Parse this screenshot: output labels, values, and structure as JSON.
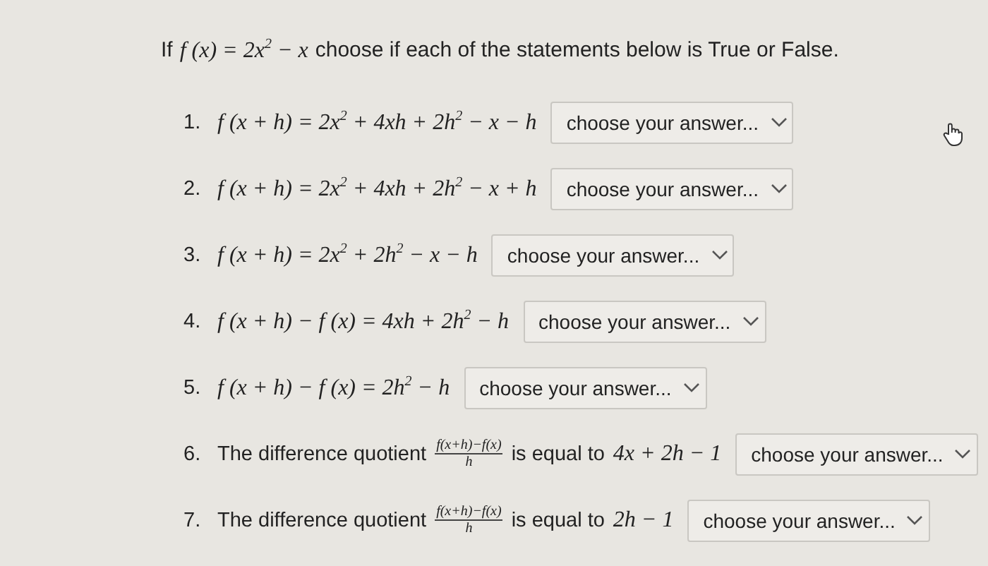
{
  "intro": {
    "prefix": "If",
    "formula": "f (x) = 2x$^{2}$ − x",
    "text": "choose if each of the statements below is True or False."
  },
  "questions": [
    {
      "number": "1.",
      "kind": "formula",
      "formula": "f (x + h) = 2x$^{2}$ + 4xh + 2h$^{2}$ − x − h",
      "answer": "choose your answer..."
    },
    {
      "number": "2.",
      "kind": "formula",
      "formula": "f (x + h) = 2x$^{2}$ + 4xh + 2h$^{2}$ − x + h",
      "answer": "choose your answer..."
    },
    {
      "number": "3.",
      "kind": "formula",
      "formula": "f (x + h) = 2x$^{2}$ + 2h$^{2}$ − x − h",
      "answer": "choose your answer..."
    },
    {
      "number": "4.",
      "kind": "formula",
      "formula": "f (x + h) − f (x) = 4xh + 2h$^{2}$ − h",
      "answer": "choose your answer..."
    },
    {
      "number": "5.",
      "kind": "formula",
      "formula": "f (x + h) − f (x) = 2h$^{2}$ − h",
      "answer": "choose your answer..."
    },
    {
      "number": "6.",
      "kind": "quotient",
      "text_before": "The difference quotient",
      "numerator": "f(x+h)−f(x)",
      "denominator": "h",
      "text_after": "is equal to",
      "formula": "4x + 2h − 1",
      "answer": "choose your answer..."
    },
    {
      "number": "7.",
      "kind": "quotient",
      "text_before": "The difference quotient",
      "numerator": "f(x+h)−f(x)",
      "denominator": "h",
      "text_after": "is equal to",
      "formula": "2h − 1",
      "answer": "choose your answer..."
    }
  ]
}
